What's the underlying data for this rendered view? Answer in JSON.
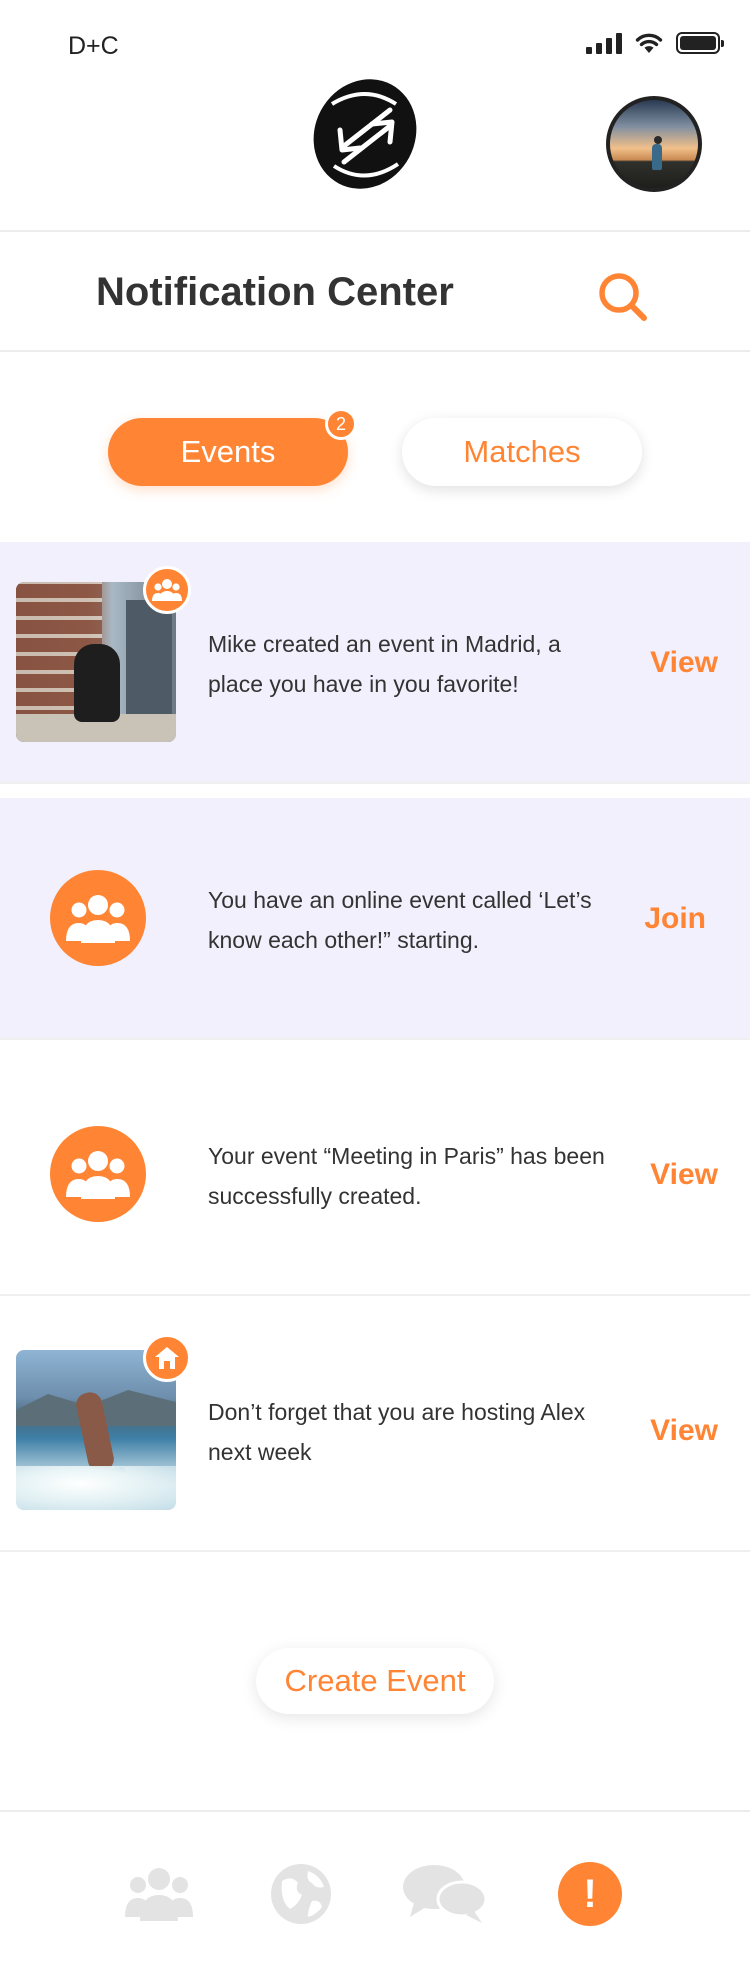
{
  "status_bar": {
    "carrier": "D+C"
  },
  "header": {
    "logo_icon": "app-logo-icon",
    "avatar_icon": "profile-avatar"
  },
  "title_bar": {
    "title": "Notification Center",
    "search_icon": "search-icon"
  },
  "tabs": [
    {
      "label": "Events",
      "active": true,
      "badge": "2"
    },
    {
      "label": "Matches",
      "active": false
    }
  ],
  "notifications": [
    {
      "text": "Mike created an event in Madrid, a place you have in you favorite!",
      "action": "View",
      "unread": true,
      "media": "photo",
      "badge_icon": "group-icon"
    },
    {
      "text": "You have an online event called ‘Let’s know each other!” starting.",
      "action": "Join",
      "unread": true,
      "media": "icon",
      "icon": "group-icon"
    },
    {
      "text": "Your event “Meeting in Paris” has been successfully created.",
      "action": "View",
      "unread": false,
      "media": "icon",
      "icon": "group-icon"
    },
    {
      "text": "Don’t forget that you are hosting Alex next week",
      "action": "View",
      "unread": false,
      "media": "photo",
      "badge_icon": "home-icon"
    }
  ],
  "create_event": {
    "label": "Create Event"
  },
  "bottom_nav": [
    {
      "icon": "people-icon",
      "active": false
    },
    {
      "icon": "globe-icon",
      "active": false
    },
    {
      "icon": "chat-icon",
      "active": false
    },
    {
      "icon": "alert-icon",
      "active": true,
      "glyph": "!"
    }
  ],
  "colors": {
    "accent": "#ff8534",
    "unread_bg": "#f2f0fc",
    "text": "#333333",
    "inactive_icon": "#e3e3e3"
  }
}
